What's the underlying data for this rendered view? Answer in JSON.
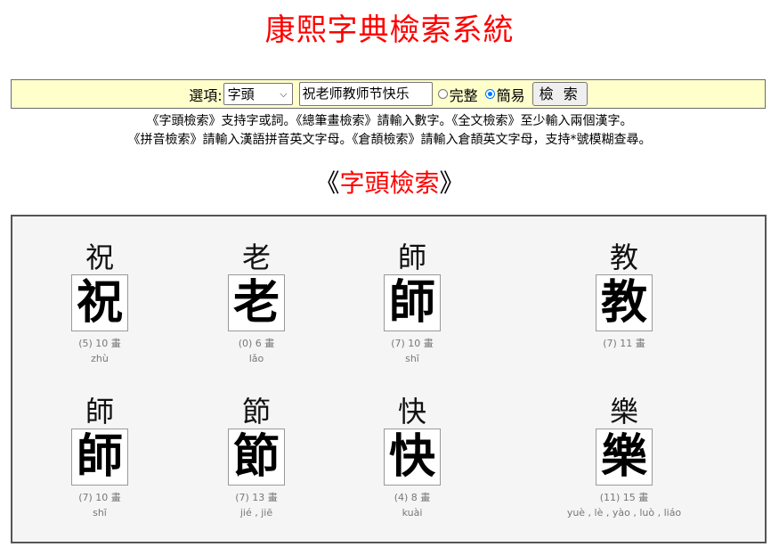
{
  "header": {
    "title": "康熙字典檢索系統"
  },
  "search": {
    "option_label": "選項:",
    "mode_selected": "字頭",
    "query_value": "祝老师教师节快乐",
    "radio_full_label": "完整",
    "radio_simple_label": "簡易",
    "selected_radio": "簡易",
    "button_label": "檢 索"
  },
  "help": {
    "line1": "《字頭檢索》支持字或詞。《總筆畫檢索》請輸入數字。《全文檢索》至少輸入兩個漢字。",
    "line2": "《拼音檢索》請輸入漢語拼音英文字母。《倉頡檢索》請輸入倉頡英文字母，支持*號模糊查尋。"
  },
  "section": {
    "open_bracket": "《",
    "title": "字頭檢索",
    "close_bracket": "》"
  },
  "results": [
    {
      "label": "祝",
      "glyph": "祝",
      "strokes": "(5) 10 畫",
      "pinyin": "zhù"
    },
    {
      "label": "老",
      "glyph": "老",
      "strokes": "(0) 6 畫",
      "pinyin": "lǎo"
    },
    {
      "label": "師",
      "glyph": "師",
      "strokes": "(7) 10 畫",
      "pinyin": "shī"
    },
    {
      "label": "教",
      "glyph": "教",
      "strokes": "(7) 11 畫",
      "pinyin": ""
    },
    {
      "label": "師",
      "glyph": "師",
      "strokes": "(7) 10 畫",
      "pinyin": "shī"
    },
    {
      "label": "節",
      "glyph": "節",
      "strokes": "(7) 13 畫",
      "pinyin": "jié , jiē"
    },
    {
      "label": "快",
      "glyph": "快",
      "strokes": "(4) 8 畫",
      "pinyin": "kuài"
    },
    {
      "label": "樂",
      "glyph": "樂",
      "strokes": "(11) 15 畫",
      "pinyin": "yuè , lè , yào , luò , liáo"
    }
  ],
  "colors": {
    "title": "#ff0000",
    "search_bg": "#ffffcc",
    "results_bg": "#f5f5f5",
    "radio_accent": "#0075ff"
  }
}
